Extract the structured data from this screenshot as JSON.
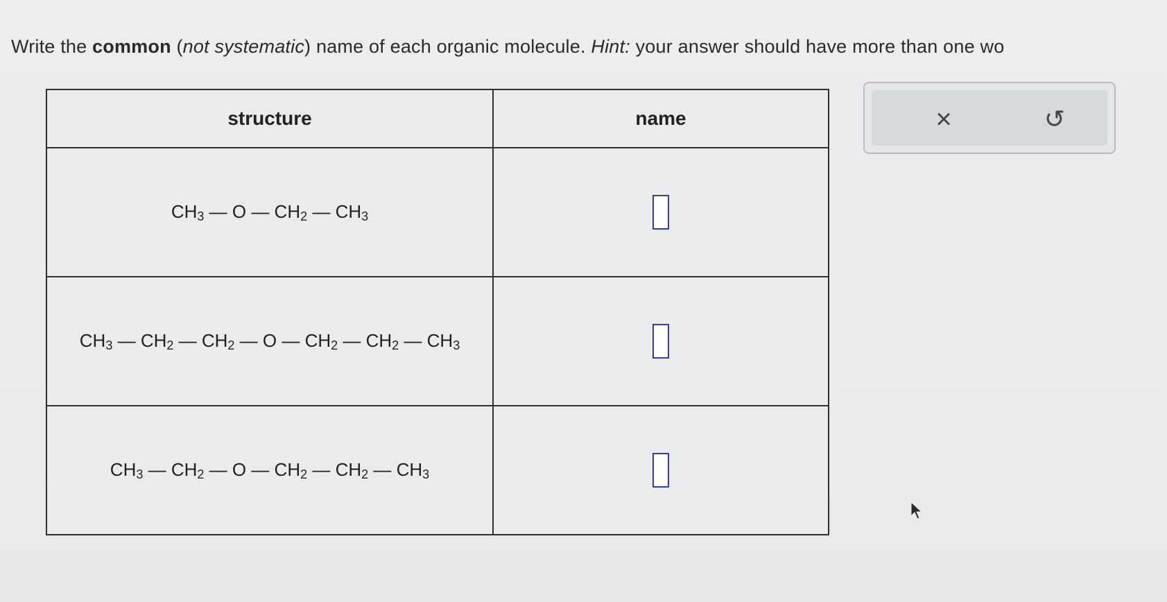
{
  "prompt": {
    "part1": "Write the ",
    "bold": "common",
    "part2": " (",
    "italic1": "not systematic",
    "part3": ") name of each organic molecule. ",
    "italic2": "Hint:",
    "part4": " your answer should have more than one wo"
  },
  "table": {
    "headers": {
      "structure": "structure",
      "name": "name"
    },
    "rows": [
      {
        "segments": [
          [
            "CH",
            "3"
          ],
          [
            "O",
            ""
          ],
          [
            "CH",
            "2"
          ],
          [
            "CH",
            "3"
          ]
        ]
      },
      {
        "segments": [
          [
            "CH",
            "3"
          ],
          [
            "CH",
            "2"
          ],
          [
            "CH",
            "2"
          ],
          [
            "O",
            ""
          ],
          [
            "CH",
            "2"
          ],
          [
            "CH",
            "2"
          ],
          [
            "CH",
            "3"
          ]
        ]
      },
      {
        "segments": [
          [
            "CH",
            "3"
          ],
          [
            "CH",
            "2"
          ],
          [
            "O",
            ""
          ],
          [
            "CH",
            "2"
          ],
          [
            "CH",
            "2"
          ],
          [
            "CH",
            "3"
          ]
        ]
      }
    ]
  },
  "tools": {
    "clear_icon": "×",
    "undo_icon": "↺"
  }
}
